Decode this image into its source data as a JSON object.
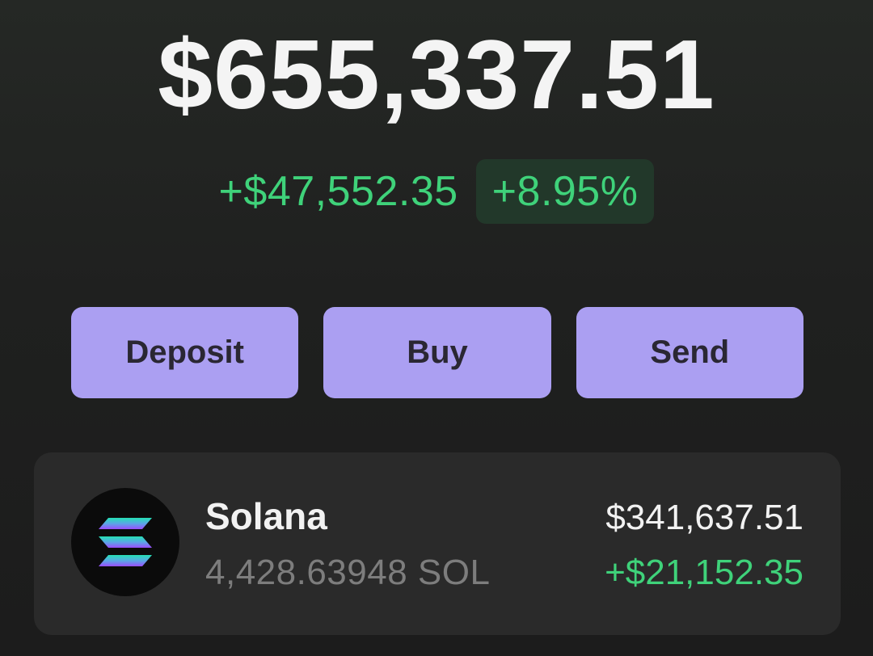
{
  "portfolio": {
    "balance": "$655,337.51",
    "change_amount": "+$47,552.35",
    "change_percent": "+8.95%"
  },
  "actions": {
    "deposit_label": "Deposit",
    "buy_label": "Buy",
    "send_label": "Send"
  },
  "tokens": [
    {
      "name": "Solana",
      "amount": "4,428.63948 SOL",
      "value": "$341,637.51",
      "change": "+$21,152.35",
      "icon": "solana-logo-icon"
    }
  ],
  "colors": {
    "background": "#1f201f",
    "positive": "#3fd27a",
    "positive_badge_bg": "#22382a",
    "button": "#ab9ff2",
    "button_text": "#2a2733",
    "card": "#2a2a2a",
    "muted_text": "#7d7d7d"
  }
}
